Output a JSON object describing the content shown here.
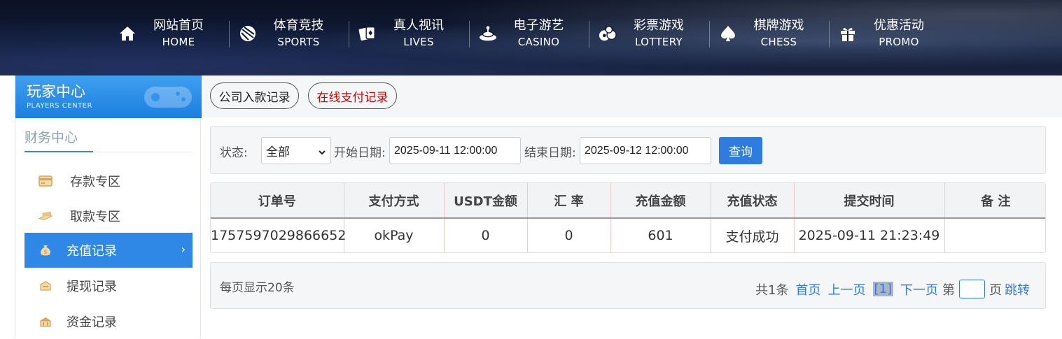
{
  "nav": {
    "items": [
      {
        "zh": "网站首页",
        "en": "HOME",
        "icon": "home-icon"
      },
      {
        "zh": "体育竞技",
        "en": "SPORTS",
        "icon": "ball-icon"
      },
      {
        "zh": "真人视讯",
        "en": "LIVES",
        "icon": "cards-icon"
      },
      {
        "zh": "电子游艺",
        "en": "CASINO",
        "icon": "slot-icon"
      },
      {
        "zh": "彩票游戏",
        "en": "LOTTERY",
        "icon": "lottery-balls-icon"
      },
      {
        "zh": "棋牌游戏",
        "en": "CHESS",
        "icon": "spade-icon"
      },
      {
        "zh": "优惠活动",
        "en": "PROMO",
        "icon": "gift-icon"
      }
    ]
  },
  "sidebar": {
    "header_zh": "玩家中心",
    "header_en": "PLAYERS CENTER",
    "section_title": "财务中心",
    "items": [
      {
        "label": "存款专区",
        "icon": "deposit-card-icon",
        "active": false
      },
      {
        "label": "取款专区",
        "icon": "withdraw-cash-icon",
        "active": false
      },
      {
        "label": "充值记录",
        "icon": "money-bag-icon",
        "active": true
      },
      {
        "label": "提现记录",
        "icon": "withdraw-record-icon",
        "active": false
      },
      {
        "label": "资金记录",
        "icon": "funds-record-icon",
        "active": false
      }
    ]
  },
  "tabs": {
    "company": "公司入款记录",
    "online": "在线支付记录"
  },
  "filter": {
    "status_label": "状态:",
    "status_value": "全部",
    "start_label": "开始日期:",
    "start_value": "2025-09-11 12:00:00",
    "end_label": "结束日期:",
    "end_value": "2025-09-12 12:00:00",
    "query_label": "查询"
  },
  "table": {
    "headers": [
      "订单号",
      "支付方式",
      "USDT金额",
      "汇 率",
      "充值金额",
      "充值状态",
      "提交时间",
      "备 注"
    ],
    "rows": [
      [
        "1757597029866652",
        "okPay",
        "0",
        "0",
        "601",
        "支付成功",
        "2025-09-11 21:23:49",
        ""
      ]
    ]
  },
  "pager": {
    "per_page": "每页显示20条",
    "total": "共1条",
    "first": "首页",
    "prev": "上一页",
    "current": "[1]",
    "next": "下一页",
    "goto_prefix": "第",
    "goto_suffix": "页",
    "jump": "跳转"
  },
  "colors": {
    "accent": "#2f87e6",
    "danger": "#d40000"
  }
}
